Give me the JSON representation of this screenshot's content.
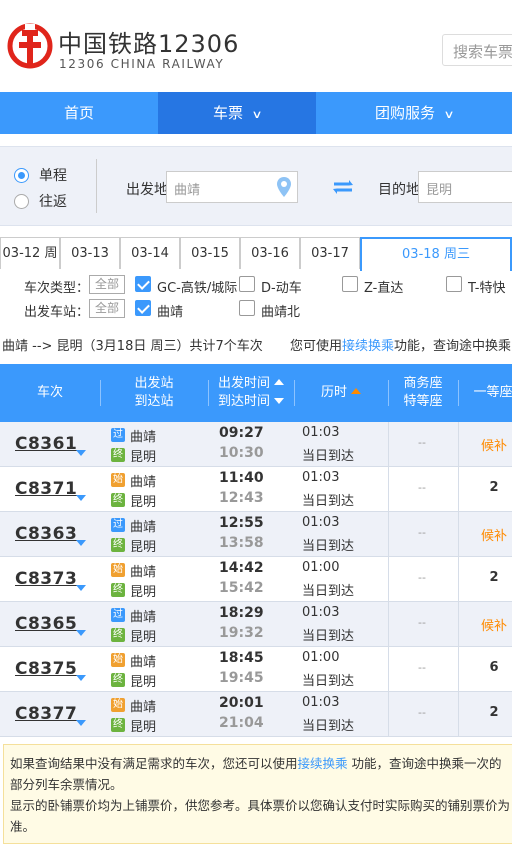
{
  "header": {
    "logo_title": "中国铁路12306",
    "logo_subtitle": "12306 CHINA RAILWAY",
    "search_placeholder": "搜索车票"
  },
  "nav": {
    "items": [
      {
        "label": "首页",
        "active": false,
        "has_dropdown": false
      },
      {
        "label": "车票",
        "active": true,
        "has_dropdown": true
      },
      {
        "label": "团购服务",
        "active": false,
        "has_dropdown": true
      }
    ]
  },
  "search": {
    "trip_types": [
      {
        "label": "单程",
        "selected": true
      },
      {
        "label": "往返",
        "selected": false
      }
    ],
    "from_label": "出发地",
    "from_value": "曲靖",
    "to_label": "目的地",
    "to_value": "昆明"
  },
  "date_tabs": [
    {
      "label": "03-12 周",
      "active": false
    },
    {
      "label": "03-13",
      "active": false
    },
    {
      "label": "03-14",
      "active": false
    },
    {
      "label": "03-15",
      "active": false
    },
    {
      "label": "03-16",
      "active": false
    },
    {
      "label": "03-17",
      "active": false
    },
    {
      "label": "03-18 周三",
      "active": true
    }
  ],
  "filters": {
    "train_type_label": "车次类型：",
    "all_label": "全部",
    "train_types": [
      {
        "label": "GC-高铁/城际",
        "checked": true
      },
      {
        "label": "D-动车",
        "checked": false
      },
      {
        "label": "Z-直达",
        "checked": false
      },
      {
        "label": "T-特快",
        "checked": false
      }
    ],
    "station_label": "出发车站：",
    "stations": [
      {
        "label": "曲靖",
        "checked": true
      },
      {
        "label": "曲靖北",
        "checked": false
      }
    ]
  },
  "summary": {
    "text": "曲靖 --> 昆明（3月18日 周三）共计7个车次",
    "hint_prefix": "您可使用",
    "hint_link": "接续换乘",
    "hint_suffix": "功能，查询途中换乘"
  },
  "table": {
    "headers": {
      "train": "车次",
      "station_from": "出发站",
      "station_to": "到达站",
      "time_dep": "出发时间",
      "time_arr": "到达时间",
      "duration": "历时",
      "business": "商务座",
      "special": "特等座",
      "first": "一等座"
    },
    "rows": [
      {
        "train": "C8361",
        "from_badge": "过",
        "from": "曲靖",
        "to_badge": "终",
        "to": "昆明",
        "dep": "09:27",
        "arr": "10:30",
        "duration": "01:03",
        "arrive_day": "当日到达",
        "business": "--",
        "first": "候补"
      },
      {
        "train": "C8371",
        "from_badge": "始",
        "from": "曲靖",
        "to_badge": "终",
        "to": "昆明",
        "dep": "11:40",
        "arr": "12:43",
        "duration": "01:03",
        "arrive_day": "当日到达",
        "business": "--",
        "first": "2"
      },
      {
        "train": "C8363",
        "from_badge": "过",
        "from": "曲靖",
        "to_badge": "终",
        "to": "昆明",
        "dep": "12:55",
        "arr": "13:58",
        "duration": "01:03",
        "arrive_day": "当日到达",
        "business": "--",
        "first": "候补"
      },
      {
        "train": "C8373",
        "from_badge": "始",
        "from": "曲靖",
        "to_badge": "终",
        "to": "昆明",
        "dep": "14:42",
        "arr": "15:42",
        "duration": "01:00",
        "arrive_day": "当日到达",
        "business": "--",
        "first": "2"
      },
      {
        "train": "C8365",
        "from_badge": "过",
        "from": "曲靖",
        "to_badge": "终",
        "to": "昆明",
        "dep": "18:29",
        "arr": "19:32",
        "duration": "01:03",
        "arrive_day": "当日到达",
        "business": "--",
        "first": "候补"
      },
      {
        "train": "C8375",
        "from_badge": "始",
        "from": "曲靖",
        "to_badge": "终",
        "to": "昆明",
        "dep": "18:45",
        "arr": "19:45",
        "duration": "01:00",
        "arrive_day": "当日到达",
        "business": "--",
        "first": "6"
      },
      {
        "train": "C8377",
        "from_badge": "始",
        "from": "曲靖",
        "to_badge": "终",
        "to": "昆明",
        "dep": "20:01",
        "arr": "21:04",
        "duration": "01:03",
        "arrive_day": "当日到达",
        "business": "--",
        "first": "2"
      }
    ]
  },
  "notice": {
    "line1_prefix": "如果查询结果中没有满足需求的车次，您还可以使用",
    "line1_link": "接续换乘",
    "line1_suffix": " 功能，查询途中换乘一次的部分列车余票情况。",
    "line2": "显示的卧铺票价均为上铺票价，供您参考。具体票价以您确认支付时实际购买的铺别票价为准。"
  },
  "colors": {
    "brand_blue": "#3b99fc",
    "nav_active": "#2676e3",
    "logo_red": "#e0251b",
    "waitlist_orange": "#ff8a00",
    "badge_pass": "#3b99fc",
    "badge_start": "#f0a030",
    "badge_end": "#6cb33f"
  }
}
